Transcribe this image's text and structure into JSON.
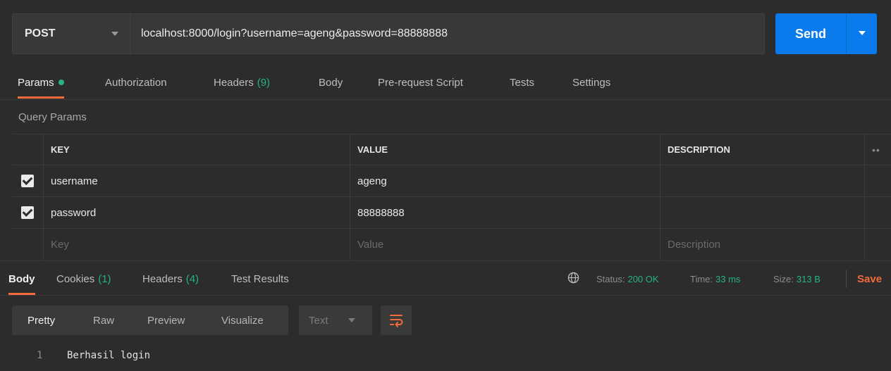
{
  "request": {
    "method": "POST",
    "url": "localhost:8000/login?username=ageng&password=88888888",
    "send_label": "Send"
  },
  "request_tabs": [
    {
      "label": "Params",
      "active": true,
      "indicator": "green-dot"
    },
    {
      "label": "Authorization"
    },
    {
      "label": "Headers",
      "count": "(9)"
    },
    {
      "label": "Body"
    },
    {
      "label": "Pre-request Script"
    },
    {
      "label": "Tests"
    },
    {
      "label": "Settings"
    }
  ],
  "query_params": {
    "title": "Query Params",
    "columns": {
      "key": "KEY",
      "value": "VALUE",
      "description": "DESCRIPTION"
    },
    "rows": [
      {
        "checked": true,
        "key": "username",
        "value": "ageng",
        "description": ""
      },
      {
        "checked": true,
        "key": "password",
        "value": "88888888",
        "description": ""
      }
    ],
    "placeholders": {
      "key": "Key",
      "value": "Value",
      "description": "Description"
    }
  },
  "response_tabs": [
    {
      "label": "Body",
      "active": true
    },
    {
      "label": "Cookies",
      "count": "(1)"
    },
    {
      "label": "Headers",
      "count": "(4)"
    },
    {
      "label": "Test Results"
    }
  ],
  "response_meta": {
    "status_label": "Status:",
    "status_value": "200 OK",
    "time_label": "Time:",
    "time_value": "33 ms",
    "size_label": "Size:",
    "size_value": "313 B",
    "save_label": "Save"
  },
  "format_tabs": [
    {
      "label": "Pretty",
      "active": true
    },
    {
      "label": "Raw"
    },
    {
      "label": "Preview"
    },
    {
      "label": "Visualize"
    }
  ],
  "format_select": "Text",
  "response_body": [
    {
      "line": "1",
      "text": "Berhasil login"
    }
  ],
  "colors": {
    "accent": "#f26b3a",
    "send": "#097bed",
    "success": "#26b47f",
    "bg": "#2c2c2c"
  },
  "icons": [
    "chevron-down-icon",
    "checkbox-checked-icon",
    "globe-icon",
    "wrap-lines-icon",
    "more-icon"
  ]
}
